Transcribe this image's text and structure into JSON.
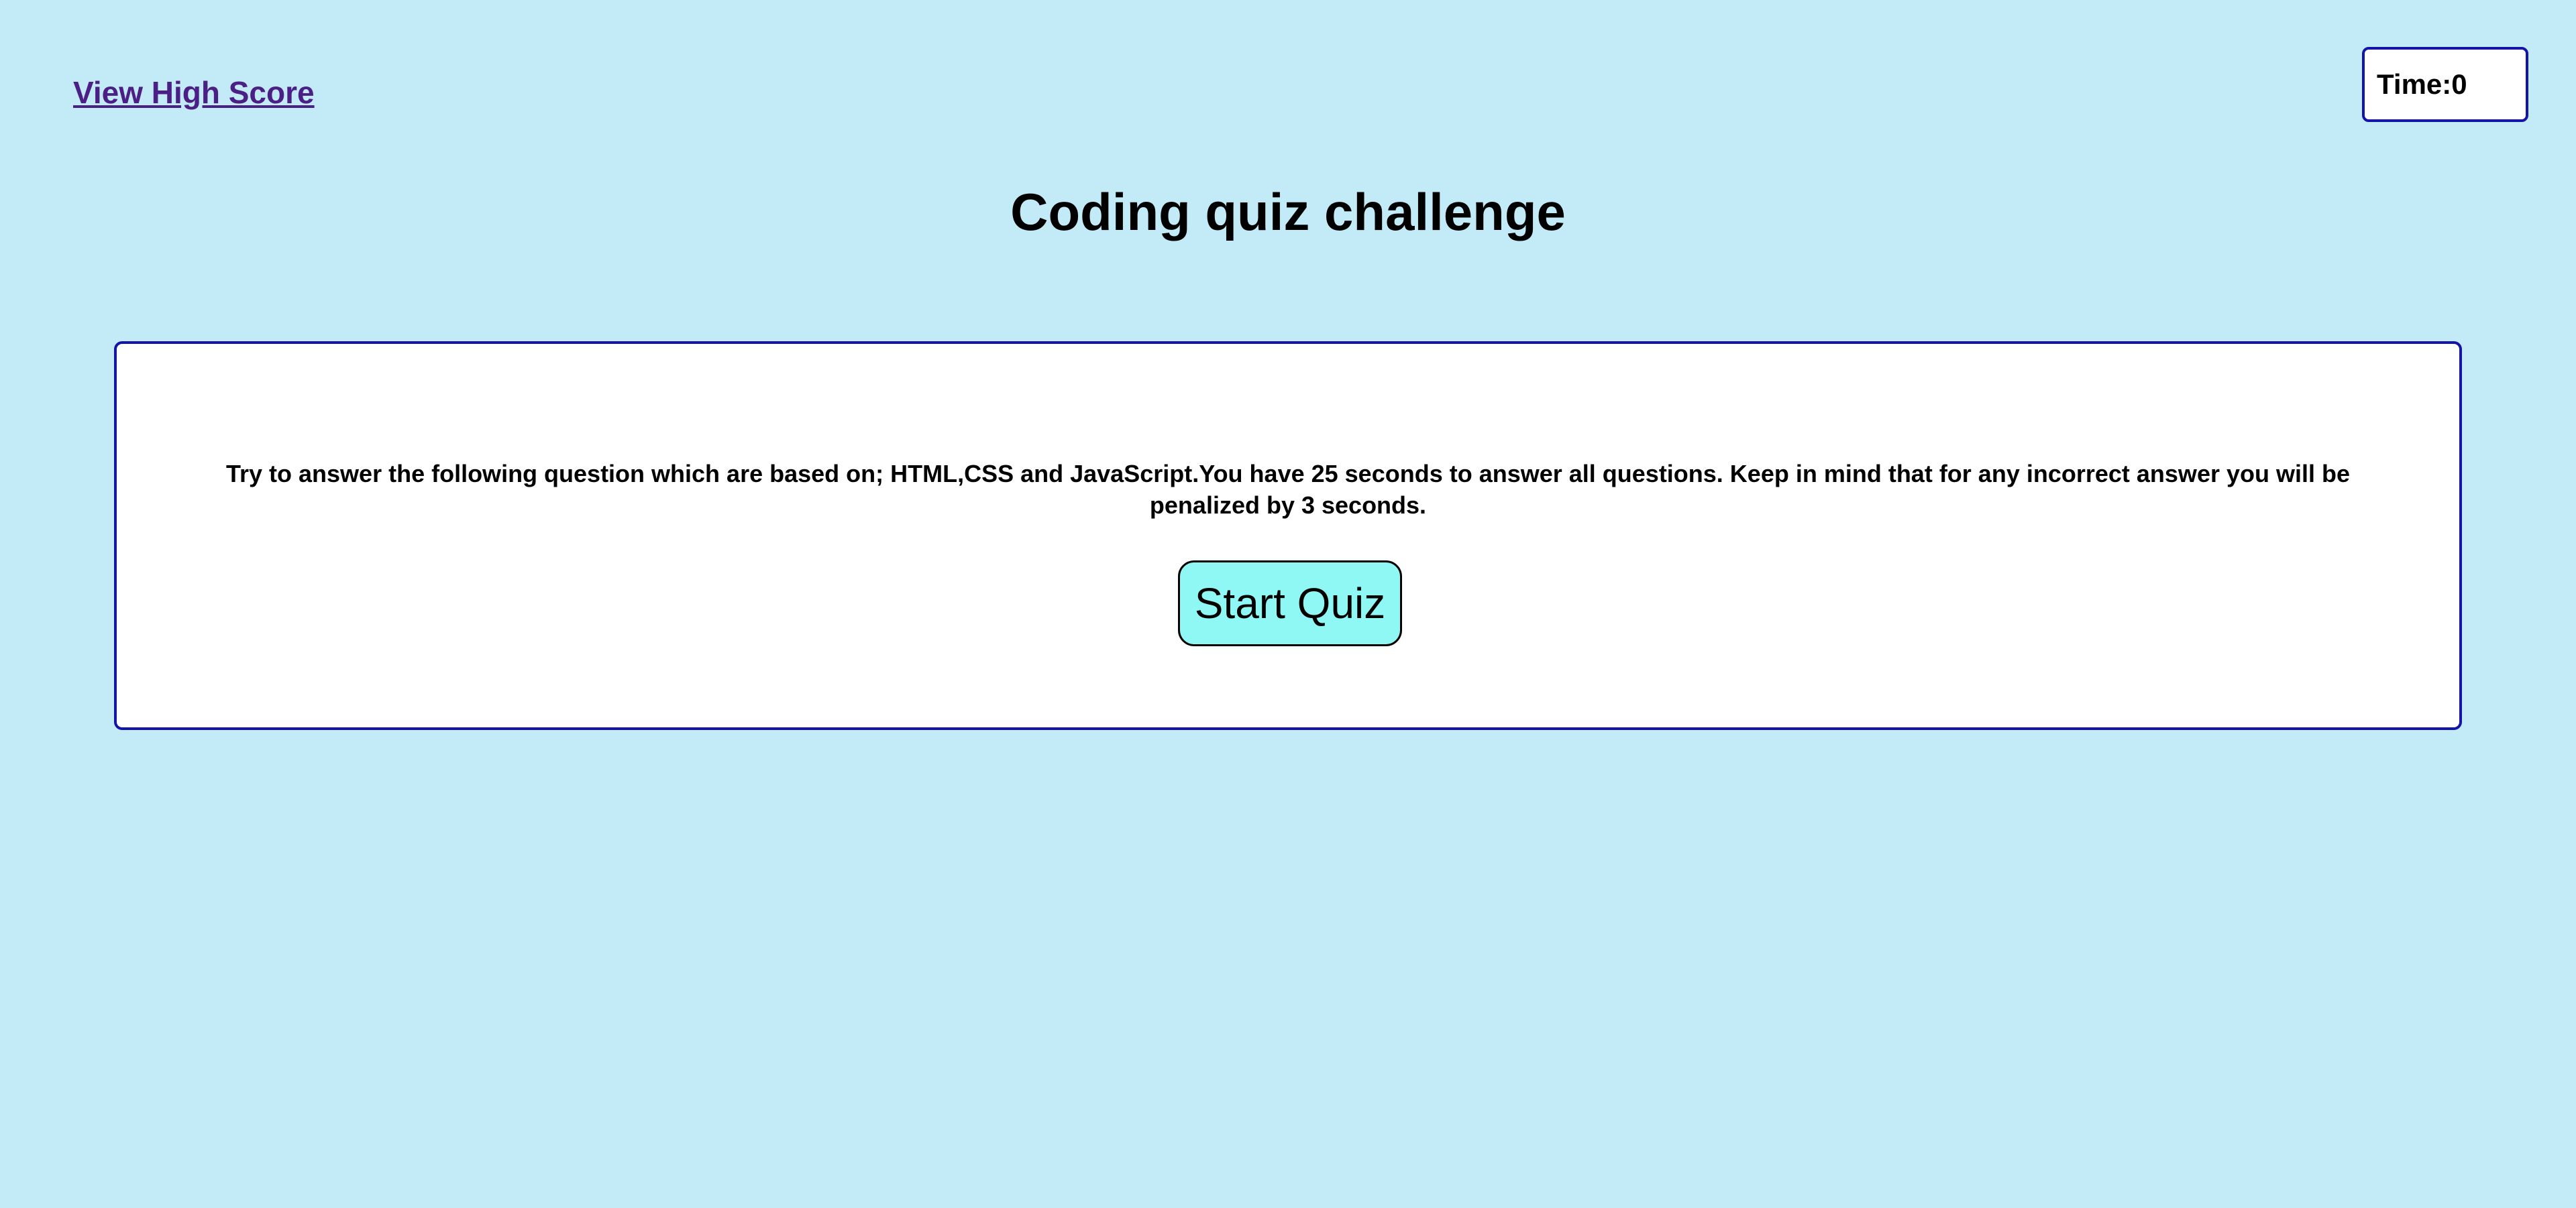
{
  "header": {
    "high_score_link": "View High Score",
    "timer": {
      "label": "Time:",
      "value": "0"
    }
  },
  "main": {
    "title": "Coding quiz challenge",
    "intro": {
      "text": "Try to answer the following question which are based on; HTML,CSS and JavaScript.You have 25 seconds to answer all questions. Keep in mind that for any incorrect answer you will be penalized by 3 seconds.",
      "start_button": "Start Quiz"
    }
  },
  "colors": {
    "background": "#c2ebf7",
    "link": "#4b1f86",
    "border": "#1414a8",
    "card": "#ffffff",
    "button": "#8ff7f4"
  }
}
